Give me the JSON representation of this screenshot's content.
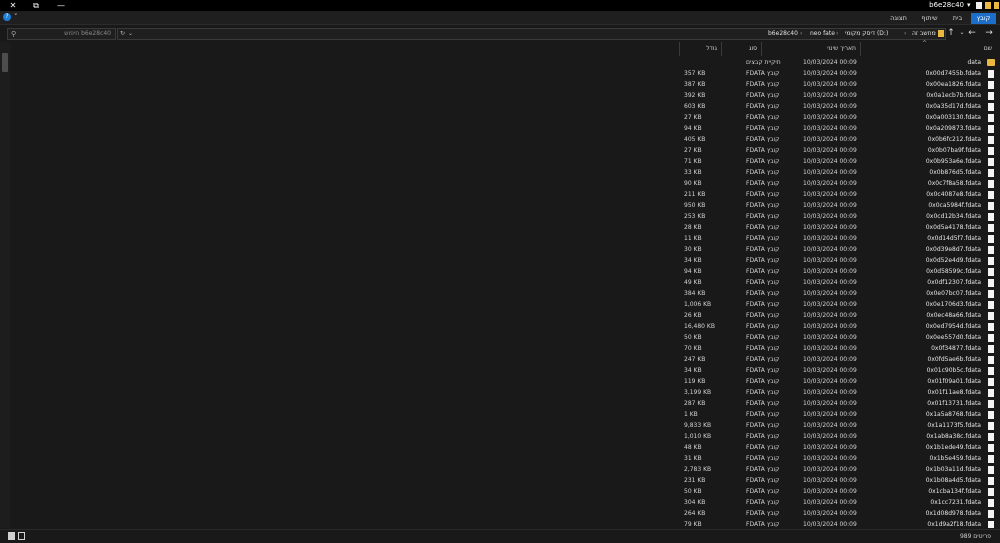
{
  "window": {
    "title": "b6e28c40",
    "controls": {
      "close": "✕",
      "restore": "⧉",
      "minimize": "—"
    }
  },
  "ribbon": {
    "tabs": [
      "קובץ",
      "בית",
      "שיתוף",
      "תצוגה"
    ],
    "active_tab": "קובץ",
    "help_label": "?",
    "toggle_label": "˅"
  },
  "search": {
    "placeholder": "חיפוש b6e28c40"
  },
  "address": {
    "crumbs": [
      "מחשב זה",
      "דיסק מקומי (D:)",
      "neo fate",
      "b6e28c40"
    ],
    "separator": "‹"
  },
  "columns": {
    "name": "שם",
    "date_modified": "תאריך שינוי",
    "type": "סוג",
    "size": "גודל"
  },
  "rows": [
    {
      "name": "data",
      "date": "10/03/2024 00:09",
      "type": "תיקיית קבצים",
      "size": "",
      "icon": "folder-icon"
    },
    {
      "name": "0x00d7455b.fdata",
      "date": "10/03/2024 00:09",
      "type": "FDATA קובץ",
      "size": "357 KB",
      "icon": "file-icon"
    },
    {
      "name": "0x00ea1826.fdata",
      "date": "10/03/2024 00:09",
      "type": "FDATA קובץ",
      "size": "387 KB",
      "icon": "file-icon"
    },
    {
      "name": "0x0a1ecb7b.fdata",
      "date": "10/03/2024 00:09",
      "type": "FDATA קובץ",
      "size": "392 KB",
      "icon": "file-icon"
    },
    {
      "name": "0x0a35d17d.fdata",
      "date": "10/03/2024 00:09",
      "type": "FDATA קובץ",
      "size": "603 KB",
      "icon": "file-icon"
    },
    {
      "name": "0x0a003130.fdata",
      "date": "10/03/2024 00:09",
      "type": "FDATA קובץ",
      "size": "27 KB",
      "icon": "file-icon"
    },
    {
      "name": "0x0a209873.fdata",
      "date": "10/03/2024 00:09",
      "type": "FDATA קובץ",
      "size": "94 KB",
      "icon": "file-icon"
    },
    {
      "name": "0x0b6fc212.fdata",
      "date": "10/03/2024 00:09",
      "type": "FDATA קובץ",
      "size": "405 KB",
      "icon": "file-icon"
    },
    {
      "name": "0x0b07ba9f.fdata",
      "date": "10/03/2024 00:09",
      "type": "FDATA קובץ",
      "size": "27 KB",
      "icon": "file-icon"
    },
    {
      "name": "0x0b953a6e.fdata",
      "date": "10/03/2024 00:09",
      "type": "FDATA קובץ",
      "size": "71 KB",
      "icon": "file-icon"
    },
    {
      "name": "0x0b876d5.fdata",
      "date": "10/03/2024 00:09",
      "type": "FDATA קובץ",
      "size": "33 KB",
      "icon": "file-icon"
    },
    {
      "name": "0x0c7f8a58.fdata",
      "date": "10/03/2024 00:09",
      "type": "FDATA קובץ",
      "size": "90 KB",
      "icon": "file-icon"
    },
    {
      "name": "0x0c4087e8.fdata",
      "date": "10/03/2024 00:09",
      "type": "FDATA קובץ",
      "size": "211 KB",
      "icon": "file-icon"
    },
    {
      "name": "0x0ca5984f.fdata",
      "date": "10/03/2024 00:09",
      "type": "FDATA קובץ",
      "size": "950 KB",
      "icon": "file-icon"
    },
    {
      "name": "0x0cd12b34.fdata",
      "date": "10/03/2024 00:09",
      "type": "FDATA קובץ",
      "size": "253 KB",
      "icon": "file-icon"
    },
    {
      "name": "0x0d5a4178.fdata",
      "date": "10/03/2024 00:09",
      "type": "FDATA קובץ",
      "size": "28 KB",
      "icon": "file-icon"
    },
    {
      "name": "0x0d14d5f7.fdata",
      "date": "10/03/2024 00:09",
      "type": "FDATA קובץ",
      "size": "11 KB",
      "icon": "file-icon"
    },
    {
      "name": "0x0d39e8d7.fdata",
      "date": "10/03/2024 00:09",
      "type": "FDATA קובץ",
      "size": "30 KB",
      "icon": "file-icon"
    },
    {
      "name": "0x0d52e4d9.fdata",
      "date": "10/03/2024 00:09",
      "type": "FDATA קובץ",
      "size": "34 KB",
      "icon": "file-icon"
    },
    {
      "name": "0x0d58599c.fdata",
      "date": "10/03/2024 00:09",
      "type": "FDATA קובץ",
      "size": "94 KB",
      "icon": "file-icon"
    },
    {
      "name": "0x0df12307.fdata",
      "date": "10/03/2024 00:09",
      "type": "FDATA קובץ",
      "size": "49 KB",
      "icon": "file-icon"
    },
    {
      "name": "0x0e07bc07.fdata",
      "date": "10/03/2024 00:09",
      "type": "FDATA קובץ",
      "size": "384 KB",
      "icon": "file-icon"
    },
    {
      "name": "0x0e1706d3.fdata",
      "date": "10/03/2024 00:09",
      "type": "FDATA קובץ",
      "size": "1,006 KB",
      "icon": "file-icon"
    },
    {
      "name": "0x0ec48a66.fdata",
      "date": "10/03/2024 00:09",
      "type": "FDATA קובץ",
      "size": "26 KB",
      "icon": "file-icon"
    },
    {
      "name": "0x0ed7954d.fdata",
      "date": "10/03/2024 00:09",
      "type": "FDATA קובץ",
      "size": "16,480 KB",
      "icon": "file-icon"
    },
    {
      "name": "0x0ee557d0.fdata",
      "date": "10/03/2024 00:09",
      "type": "FDATA קובץ",
      "size": "50 KB",
      "icon": "file-icon"
    },
    {
      "name": "0x0f34877.fdata",
      "date": "10/03/2024 00:09",
      "type": "FDATA קובץ",
      "size": "70 KB",
      "icon": "file-icon"
    },
    {
      "name": "0x0fd5ae6b.fdata",
      "date": "10/03/2024 00:09",
      "type": "FDATA קובץ",
      "size": "247 KB",
      "icon": "file-icon"
    },
    {
      "name": "0x01c90b5c.fdata",
      "date": "10/03/2024 00:09",
      "type": "FDATA קובץ",
      "size": "34 KB",
      "icon": "file-icon"
    },
    {
      "name": "0x01f09a01.fdata",
      "date": "10/03/2024 00:09",
      "type": "FDATA קובץ",
      "size": "119 KB",
      "icon": "file-icon"
    },
    {
      "name": "0x01f11ae8.fdata",
      "date": "10/03/2024 00:09",
      "type": "FDATA קובץ",
      "size": "3,199 KB",
      "icon": "file-icon"
    },
    {
      "name": "0x01f13731.fdata",
      "date": "10/03/2024 00:09",
      "type": "FDATA קובץ",
      "size": "287 KB",
      "icon": "file-icon"
    },
    {
      "name": "0x1a5a8768.fdata",
      "date": "10/03/2024 00:09",
      "type": "FDATA קובץ",
      "size": "1 KB",
      "icon": "file-icon"
    },
    {
      "name": "0x1a1173f5.fdata",
      "date": "10/03/2024 00:09",
      "type": "FDATA קובץ",
      "size": "9,833 KB",
      "icon": "file-icon"
    },
    {
      "name": "0x1ab8a38c.fdata",
      "date": "10/03/2024 00:09",
      "type": "FDATA קובץ",
      "size": "1,010 KB",
      "icon": "file-icon"
    },
    {
      "name": "0x1b1ede49.fdata",
      "date": "10/03/2024 00:09",
      "type": "FDATA קובץ",
      "size": "48 KB",
      "icon": "file-icon"
    },
    {
      "name": "0x1b5e459.fdata",
      "date": "10/03/2024 00:09",
      "type": "FDATA קובץ",
      "size": "31 KB",
      "icon": "file-icon"
    },
    {
      "name": "0x1b03a11d.fdata",
      "date": "10/03/2024 00:09",
      "type": "FDATA קובץ",
      "size": "2,783 KB",
      "icon": "file-icon"
    },
    {
      "name": "0x1b08a4d5.fdata",
      "date": "10/03/2024 00:09",
      "type": "FDATA קובץ",
      "size": "231 KB",
      "icon": "file-icon"
    },
    {
      "name": "0x1cba134f.fdata",
      "date": "10/03/2024 00:09",
      "type": "FDATA קובץ",
      "size": "50 KB",
      "icon": "file-icon"
    },
    {
      "name": "0x1cc7231.fdata",
      "date": "10/03/2024 00:09",
      "type": "FDATA קובץ",
      "size": "304 KB",
      "icon": "file-icon"
    },
    {
      "name": "0x1d08d978.fdata",
      "date": "10/03/2024 00:09",
      "type": "FDATA קובץ",
      "size": "264 KB",
      "icon": "file-icon"
    },
    {
      "name": "0x1d9a2f18.fdata",
      "date": "10/03/2024 00:09",
      "type": "FDATA קובץ",
      "size": "79 KB",
      "icon": "file-icon"
    }
  ],
  "status": {
    "item_count": "989 פריטים"
  },
  "colors": {
    "background": "#191919",
    "titlebar": "#000000",
    "accent": "#1c6ec9",
    "folder": "#e9b93e",
    "file": "#f4f4f4"
  }
}
